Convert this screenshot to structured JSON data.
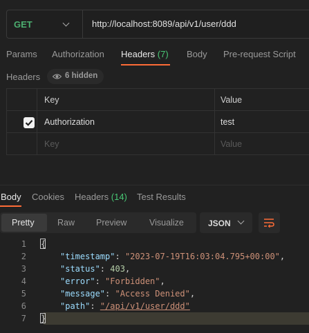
{
  "request": {
    "method": "GET",
    "url": "http://localhost:8089/api/v1/user/ddd"
  },
  "request_tabs": [
    {
      "label": "Params"
    },
    {
      "label": "Authorization"
    },
    {
      "label": "Headers",
      "count": "(7)"
    },
    {
      "label": "Body"
    },
    {
      "label": "Pre-request Script"
    }
  ],
  "headers_section": {
    "title": "Headers",
    "hidden_label": "6 hidden",
    "columns": {
      "key": "Key",
      "value": "Value"
    },
    "rows": [
      {
        "key": "Authorization",
        "value": "test",
        "checked": true
      }
    ],
    "placeholder": {
      "key": "Key",
      "value": "Value"
    }
  },
  "response_tabs": [
    {
      "label": "Body"
    },
    {
      "label": "Cookies"
    },
    {
      "label": "Headers",
      "count": "(14)"
    },
    {
      "label": "Test Results"
    }
  ],
  "view_modes": [
    "Pretty",
    "Raw",
    "Preview",
    "Visualize"
  ],
  "format": "JSON",
  "code": {
    "line_numbers": [
      "1",
      "2",
      "3",
      "4",
      "5",
      "6",
      "7"
    ],
    "open_brace": "{",
    "close_brace": "}",
    "fields": [
      {
        "key": "\"timestamp\"",
        "value": "\"2023-07-19T16:03:04.795+00:00\"",
        "type": "string",
        "trail": ","
      },
      {
        "key": "\"status\"",
        "value": "403",
        "type": "number",
        "trail": ","
      },
      {
        "key": "\"error\"",
        "value": "\"Forbidden\"",
        "type": "string",
        "trail": ","
      },
      {
        "key": "\"message\"",
        "value": "\"Access Denied\"",
        "type": "string",
        "trail": ","
      },
      {
        "key": "\"path\"",
        "value": "\"/api/v1/user/ddd\"",
        "type": "link",
        "trail": ""
      }
    ]
  },
  "colors": {
    "accent": "#ff6c37",
    "method": "#4caf70",
    "count": "#48c774"
  }
}
